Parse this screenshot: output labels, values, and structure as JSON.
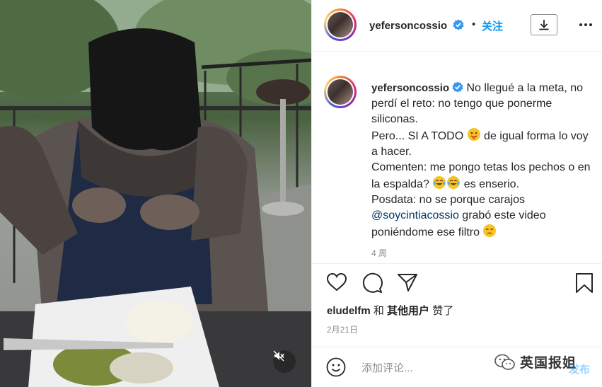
{
  "post": {
    "username": "yefersoncossio",
    "follow_label": "关注",
    "header_separator": "•",
    "verified": true
  },
  "caption": {
    "username": "yefersoncossio",
    "line1": "No llegué a la meta, no perdí el reto: no tengo que ponerme siliconas.",
    "line2_pre": "Pero... SI A TODO",
    "line2_post": "de igual forma lo voy a hacer.",
    "line3_pre": "Comenten: me pongo tetas los pechos o en la espalda?",
    "line3_post": "es enserio.",
    "line4": "Posdata: no se porque carajos",
    "mention": "@soycintiacossio",
    "line5_post": "grabó este video poniéndome ese filtro",
    "time_ago": "4 周"
  },
  "likes": {
    "user": "eludelfm",
    "conjunction": "和",
    "others": "其他用户",
    "suffix": "赞了"
  },
  "date": "2月21日",
  "comment": {
    "placeholder": "添加评论...",
    "publish_label": "发布"
  },
  "watermark": {
    "text": "英国报姐"
  },
  "icons": {
    "verified": "verified-badge-icon",
    "download": "download-icon",
    "more": "more-options-icon",
    "like": "heart-icon",
    "comment": "comment-icon",
    "share": "share-paper-plane-icon",
    "save": "bookmark-icon",
    "emoji": "emoji-smile-icon",
    "mute": "muted-speaker-icon"
  },
  "colors": {
    "accent": "#0095f6",
    "mention": "#00376b",
    "text": "#262626",
    "muted": "#8e8e8e",
    "verified": "#3897f0"
  }
}
